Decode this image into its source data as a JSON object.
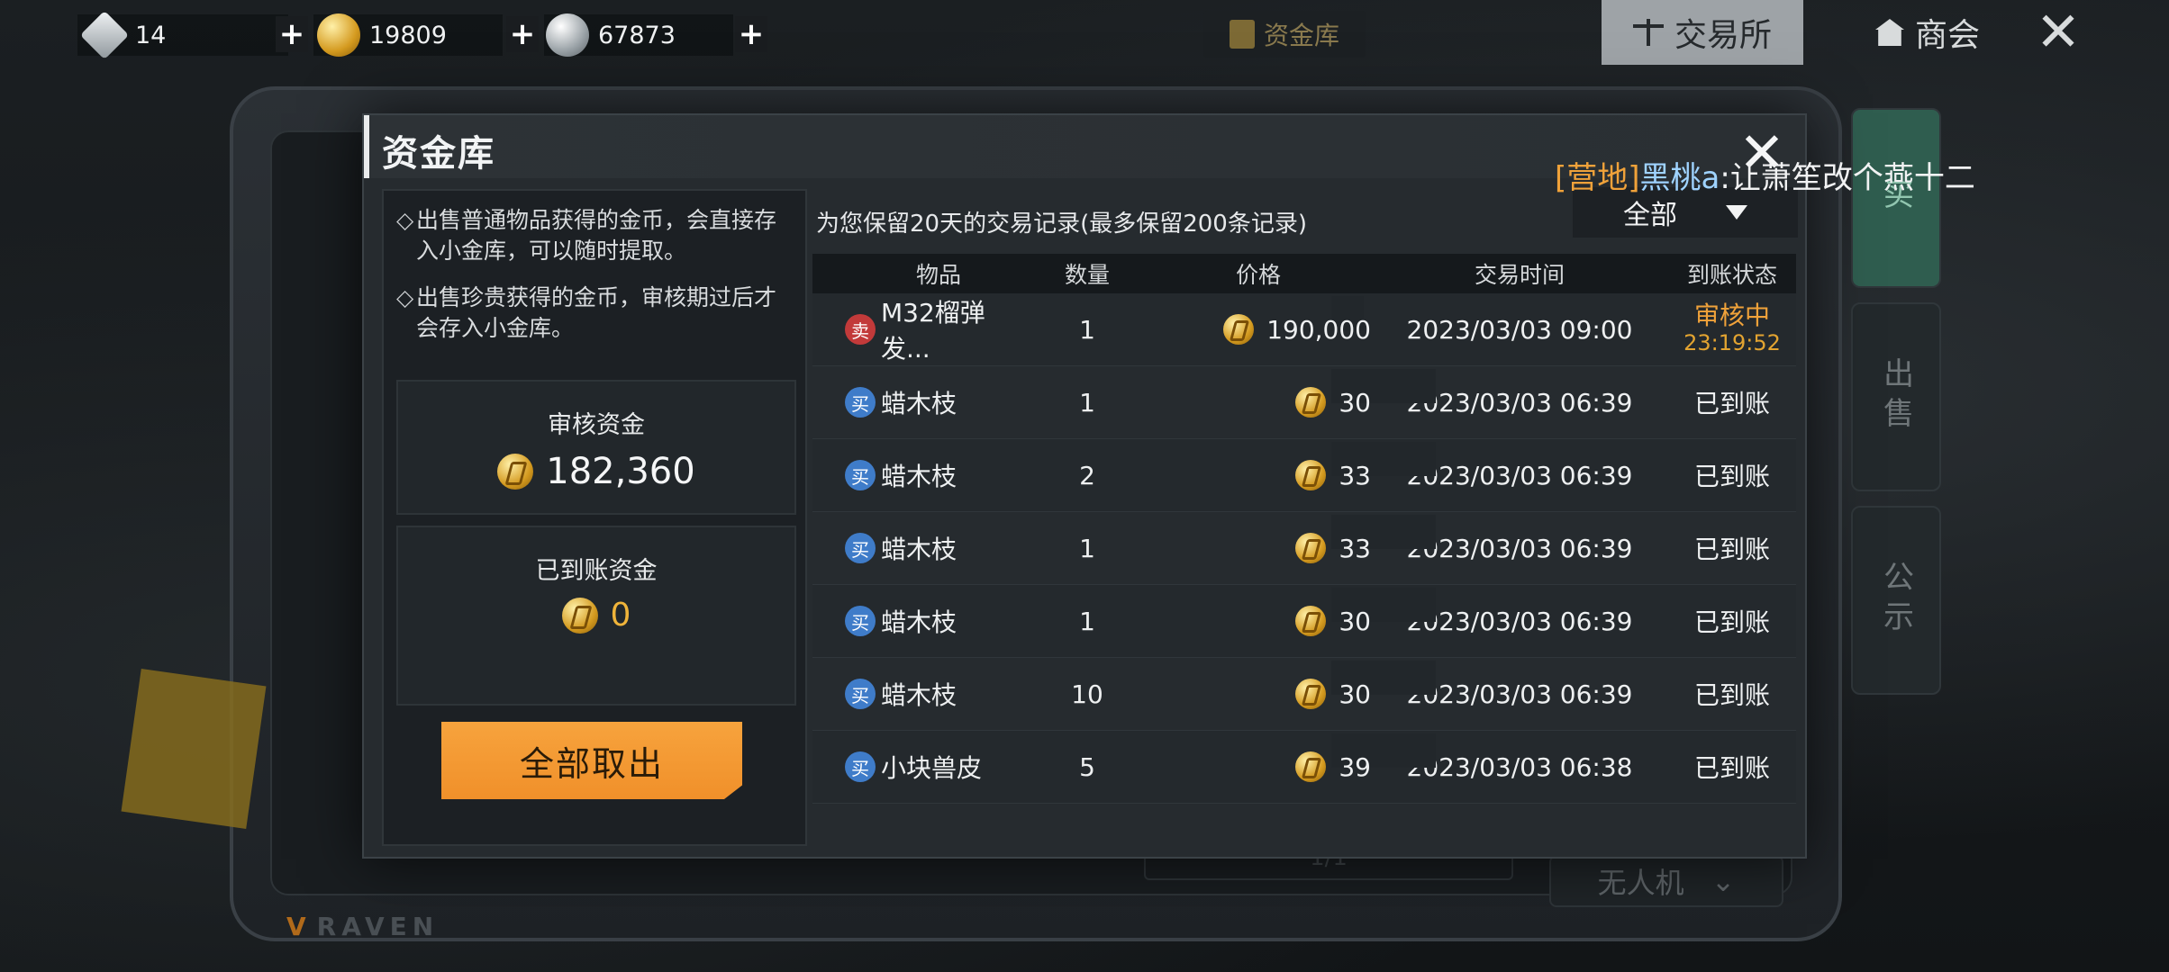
{
  "currencies": [
    {
      "name": "diamond-icon",
      "value": "14"
    },
    {
      "name": "gold-coin-icon",
      "value": "19809"
    },
    {
      "name": "silver-coin-icon",
      "value": "67873"
    }
  ],
  "top_tabs": {
    "vault": "资金库",
    "exchange": "交易所",
    "guild": "商会",
    "close": "✕"
  },
  "background": {
    "side_tabs": [
      "买",
      "出售",
      "公示"
    ],
    "dropdown": "无人机",
    "brand": "RAVEN",
    "pager": "1/1"
  },
  "panel": {
    "title": "资金库",
    "close": "✕",
    "notices": [
      "出售普通物品获得的金币，会直接存入小金库，可以随时提取。",
      "出售珍贵获得的金币，审核期过后才会存入小金库。"
    ],
    "review_label": "审核资金",
    "review_value": "182,360",
    "arrived_label": "已到账资金",
    "arrived_value": "0",
    "withdraw_label": "全部取出",
    "records_note": "为您保留20天的交易记录(最多保留200条记录)",
    "filter_value": "全部",
    "columns": {
      "item": "物品",
      "qty": "数量",
      "price": "价格",
      "time": "交易时间",
      "status": "到账状态"
    },
    "rows": [
      {
        "type_label": "卖",
        "type": "sell",
        "item": "M32榴弹发...",
        "qty": "1",
        "price": "190,000",
        "time": "2023/03/03  09:00",
        "status": "审核中",
        "status_sub": "23:19:52"
      },
      {
        "type_label": "买",
        "type": "buy",
        "item": "蜡木枝",
        "qty": "1",
        "price": "30",
        "time": "2023/03/03  06:39",
        "status": "已到账",
        "status_sub": ""
      },
      {
        "type_label": "买",
        "type": "buy",
        "item": "蜡木枝",
        "qty": "2",
        "price": "33",
        "time": "2023/03/03  06:39",
        "status": "已到账",
        "status_sub": ""
      },
      {
        "type_label": "买",
        "type": "buy",
        "item": "蜡木枝",
        "qty": "1",
        "price": "33",
        "time": "2023/03/03  06:39",
        "status": "已到账",
        "status_sub": ""
      },
      {
        "type_label": "买",
        "type": "buy",
        "item": "蜡木枝",
        "qty": "1",
        "price": "30",
        "time": "2023/03/03  06:39",
        "status": "已到账",
        "status_sub": ""
      },
      {
        "type_label": "买",
        "type": "buy",
        "item": "蜡木枝",
        "qty": "10",
        "price": "30",
        "time": "2023/03/03  06:39",
        "status": "已到账",
        "status_sub": ""
      },
      {
        "type_label": "买",
        "type": "buy",
        "item": "小块兽皮",
        "qty": "5",
        "price": "39",
        "time": "2023/03/03  06:38",
        "status": "已到账",
        "status_sub": ""
      }
    ]
  },
  "chat": {
    "channel": "[营地]",
    "name": "黑桃a",
    "message": ":让萧笙改个燕十二"
  },
  "colors": {
    "accent_orange": "#f0902a",
    "review_status": "#f0a23a",
    "sell_badge": "#c23a3a",
    "buy_badge": "#3f7cc9",
    "chat_name": "#9fd3ff"
  }
}
